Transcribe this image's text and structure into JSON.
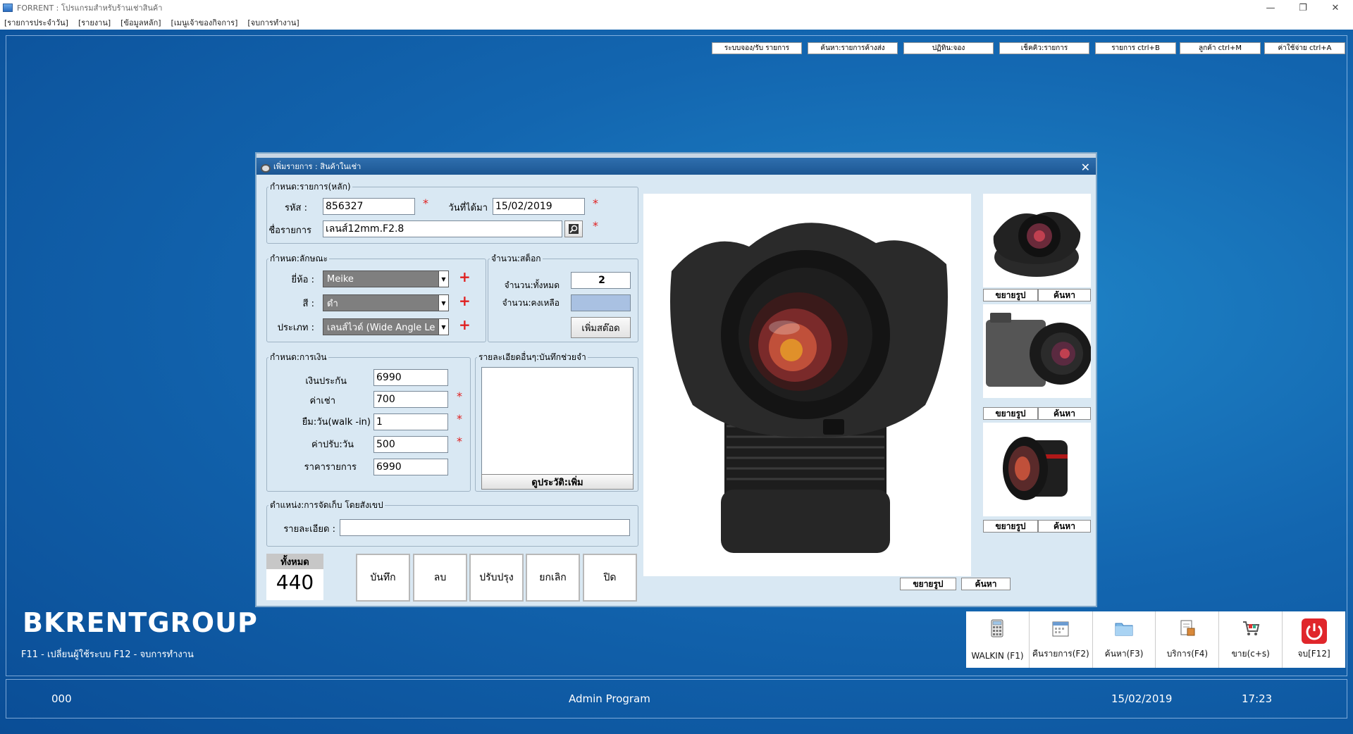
{
  "window": {
    "title": "FORRENT : โปรแกรมสำหรับร้านเช่าสินค้า",
    "minimize": "—",
    "restore": "❐",
    "close": "✕"
  },
  "menubar": [
    "[รายการประจำวัน]",
    "[รายงาน]",
    "[ข้อมูลหลัก]",
    "[เมนูเจ้าของกิจการ]",
    "[จบการทำงาน]"
  ],
  "top_buttons": [
    "ระบบจอง/รับ รายการ",
    "ค้นหา:รายการค้างส่ง",
    "ปฏิทิน:จอง",
    "เช็คคิว:รายการ",
    "รายการ ctrl+B",
    "ลูกค้า ctrl+M",
    "ค่าใช้จ่าย ctrl+A"
  ],
  "brand": {
    "name": "BKRENTGROUP",
    "shortcuts": "F11 - เปลี่ยนผู้ใช้ระบบ    F12 - จบการทำงาน"
  },
  "toolbar": [
    {
      "label": "WALKIN  (F1)",
      "icon": "calculator-icon"
    },
    {
      "label": "คืนรายการ(F2)",
      "icon": "calendar-icon"
    },
    {
      "label": "ค้นหา(F3)",
      "icon": "folder-icon"
    },
    {
      "label": "บริการ(F4)",
      "icon": "document-icon"
    },
    {
      "label": "ขาย(c+s)",
      "icon": "cart-icon"
    },
    {
      "label": "จบ[F12]",
      "icon": "power-icon"
    }
  ],
  "statusbar": {
    "code": "000",
    "program": "Admin Program",
    "date": "15/02/2019",
    "time": "17:23"
  },
  "dialog": {
    "title": "เพิ่มรายการ : สินค้าในเช่า",
    "close": "✕",
    "main_group": {
      "legend": "กำหนด:รายการ(หลัก)",
      "code_label": "รหัส :",
      "code_value": "856327",
      "date_label": "วันที่ได้มา",
      "date_value": "15/02/2019",
      "name_label": "ชื่อรายการ",
      "name_value": "เลนส์12mm.F2.8"
    },
    "attr_group": {
      "legend": "กำหนด:ลักษณะ",
      "brand_label": "ยี่ห้อ :",
      "brand_value": "Meike",
      "color_label": "สี :",
      "color_value": "ดำ",
      "type_label": "ประเภท :",
      "type_value": "เลนส์ไวด์ (Wide Angle Le"
    },
    "stock_group": {
      "legend": "จำนวน:สต็อก",
      "total_label": "จำนวน:ทั้งหมด",
      "total_value": "2",
      "remain_label": "จำนวน:คงเหลือ",
      "add_button": "เพิ่มสต๊อด"
    },
    "money_group": {
      "legend": "กำหนด:การเงิน",
      "deposit_label": "เงินประกัน",
      "deposit_value": "6990",
      "rent_label": "ค่าเช่า",
      "rent_value": "700",
      "days_label": "ยืม:วัน(walk -in)",
      "days_value": "1",
      "fine_label": "ค่าปรับ:วัน",
      "fine_value": "500",
      "price_label": "ราคารายการ",
      "price_value": "6990"
    },
    "notes_group": {
      "legend": "รายละเอียดอื่นๆ:บันทึกช่วยจำ",
      "history_button": "ดูประวัติ:เพิ่ม"
    },
    "location_group": {
      "legend": "ตำแหน่ง:การจัดเก็บ โดยสังเขป",
      "detail_label": "รายละเอียด :"
    },
    "total": {
      "label": "ทั้งหมด",
      "value": "440"
    },
    "actions": [
      "บันทึก",
      "ลบ",
      "ปรับปรุง",
      "ยกเลิก",
      "ปิด"
    ],
    "image_buttons": {
      "enlarge": "ขยายรูป",
      "search": "ค้นหา"
    }
  }
}
